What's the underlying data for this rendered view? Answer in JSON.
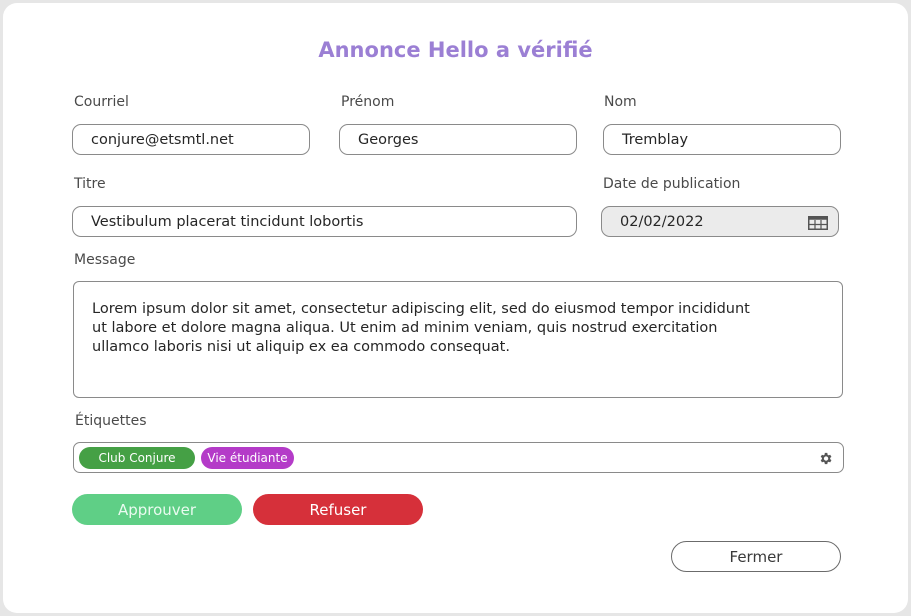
{
  "dialog": {
    "title": "Annonce Hello a vérifié"
  },
  "form": {
    "email": {
      "label": "Courriel",
      "value": "conjure@etsmtl.net"
    },
    "first_name": {
      "label": "Prénom",
      "value": "Georges"
    },
    "last_name": {
      "label": "Nom",
      "value": "Tremblay"
    },
    "title": {
      "label": "Titre",
      "value": "Vestibulum placerat tincidunt lobortis"
    },
    "publish_date": {
      "label": "Date de publication",
      "value": "02/02/2022",
      "icon": "calendar-icon"
    },
    "message": {
      "label": "Message",
      "lines": [
        "Lorem ipsum dolor sit amet, consectetur adipiscing elit, sed do eiusmod tempor incididunt",
        "ut labore et dolore magna aliqua. Ut enim ad minim veniam, quis nostrud exercitation",
        "ullamco laboris nisi ut aliquip ex ea commodo consequat."
      ]
    },
    "tags": {
      "label": "Étiquettes",
      "items": [
        {
          "label": "Club Conjure",
          "color": "#45a045"
        },
        {
          "label": "Vie étudiante",
          "color": "#b43bc8"
        }
      ],
      "settings_icon": "gear-icon"
    }
  },
  "actions": {
    "approve_label": "Approuver",
    "refuse_label": "Refuser",
    "close_label": "Fermer"
  },
  "colors": {
    "title": "#9b7fd4",
    "approve": "#5fcf86",
    "refuse": "#d6303a"
  }
}
